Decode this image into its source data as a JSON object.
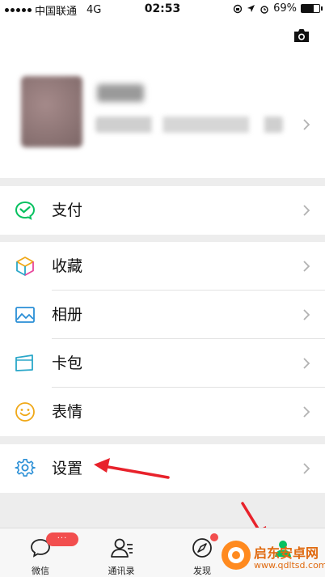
{
  "status_bar": {
    "carrier": "中国联通",
    "network": "4G",
    "time": "02:53",
    "battery": "69%",
    "battery_level": 0.69
  },
  "profile": {
    "camera_icon": "camera-icon",
    "chevron_icon": "chevron-right-icon"
  },
  "menu": {
    "pay": {
      "label": "支付",
      "icon": "pay-icon",
      "color": "#07c160"
    },
    "favorites": {
      "label": "收藏",
      "icon": "favorites-cube-icon"
    },
    "album": {
      "label": "相册",
      "icon": "album-icon",
      "color": "#2a8fd6"
    },
    "cards": {
      "label": "卡包",
      "icon": "card-wallet-icon",
      "color": "#2aa7c9"
    },
    "stickers": {
      "label": "表情",
      "icon": "sticker-smile-icon",
      "color": "#f0a818"
    },
    "settings": {
      "label": "设置",
      "icon": "gear-icon",
      "color": "#2a8fd6"
    }
  },
  "tabbar": {
    "chats": {
      "label": "微信",
      "badge": "···",
      "icon": "chat-bubble-icon"
    },
    "contacts": {
      "label": "通讯录",
      "icon": "contacts-icon"
    },
    "discover": {
      "label": "发现",
      "icon": "compass-icon"
    },
    "me": {
      "icon": "me-icon"
    }
  },
  "annotations": {
    "arrow_color": "#e8222b"
  },
  "watermark": {
    "title": "启东安卓网",
    "url": "www.qdltsd.com"
  }
}
